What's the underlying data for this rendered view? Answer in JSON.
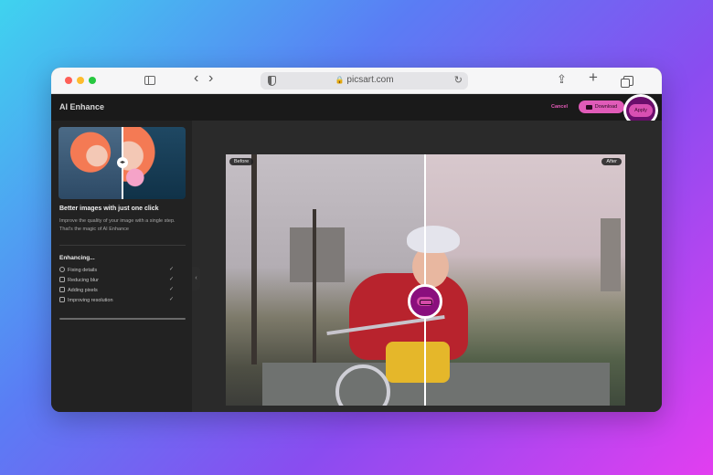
{
  "browser": {
    "url": "picsart.com"
  },
  "app": {
    "title": "AI Enhance",
    "cancel_label": "Cancel",
    "download_label": "Download",
    "apply_label": "Apply"
  },
  "panel": {
    "promo_title": "Better images with just one click",
    "promo_desc": "Improve the quality of your image with a single step. That's the magic of AI Enhance",
    "enhancing_title": "Enhancing...",
    "steps": [
      {
        "label": "Fixing details",
        "icon": "sparkle-icon",
        "done": true
      },
      {
        "label": "Reducing blur",
        "icon": "blur-icon",
        "done": true
      },
      {
        "label": "Adding pixels",
        "icon": "pixels-icon",
        "done": true
      },
      {
        "label": "Improving resolution",
        "icon": "resolution-icon",
        "done": true
      }
    ]
  },
  "canvas": {
    "before_label": "Before",
    "after_label": "After"
  },
  "colors": {
    "accent": "#e05bb8",
    "highlight_ring": "#6a0e6c"
  }
}
